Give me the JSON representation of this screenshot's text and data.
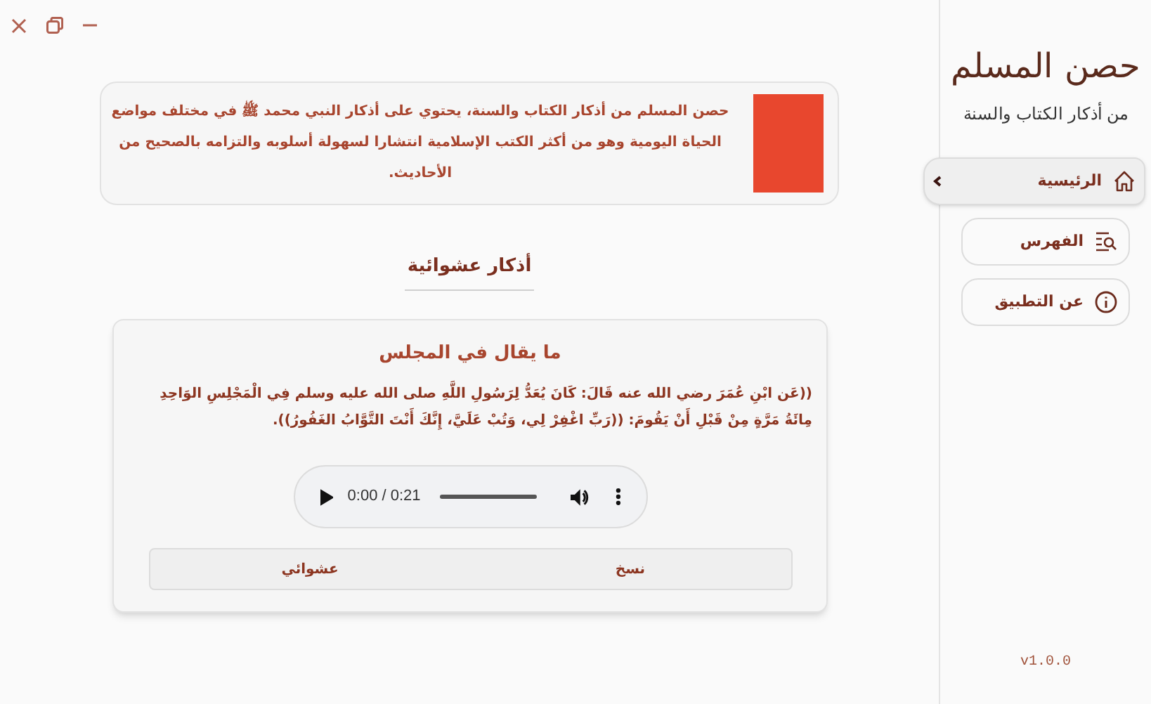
{
  "window_controls": [
    {
      "kind": "close"
    },
    {
      "kind": "restore"
    },
    {
      "kind": "minimize"
    }
  ],
  "intro": {
    "text": "حصن المسلم من أذكار الكتاب والسنة، يحتوي على أذكار النبي محمد ﷺ في مختلف مواضع الحياة اليومية وهو من أكثر الكتب الإسلامية انتشارا لسهولة أسلوبه والتزامه بالصحيح من الأحاديث."
  },
  "section_title": "أذكار عشوائية",
  "dhikr": {
    "title": "ما يقال في المجلس",
    "text": "((عَن ابْنِ عُمَرَ رضي الله عنه قَالَ: كَانَ يُعَدُّ لِرَسُولِ اللَّهِ صلى الله عليه وسلم فِي الْمَجْلِسِ الوَاحِدِ مِائَةُ مَرَّةٍ مِنْ قَبْلِ أَنْ يَقُومَ: ((رَبِّ اغْفِرْ لِي، وَتُبْ عَلَيَّ، إِنَّكَ أَنْتَ التَّوَّابُ الغَفُورُ)).",
    "audio": {
      "time": "0:00 / 0:21"
    },
    "actions": [
      "نسخ",
      "عشوائي"
    ]
  },
  "sidebar": {
    "logo_title": "حصن المسلم",
    "logo_subtitle": "من أذكار الكتاب والسنة",
    "items": [
      {
        "label": "الرئيسية",
        "kind": "home",
        "selected": true
      },
      {
        "label": "الفهرس",
        "kind": "index",
        "selected": false
      },
      {
        "label": "عن التطبيق",
        "kind": "info",
        "selected": false
      }
    ],
    "version": "v1.0.0"
  }
}
